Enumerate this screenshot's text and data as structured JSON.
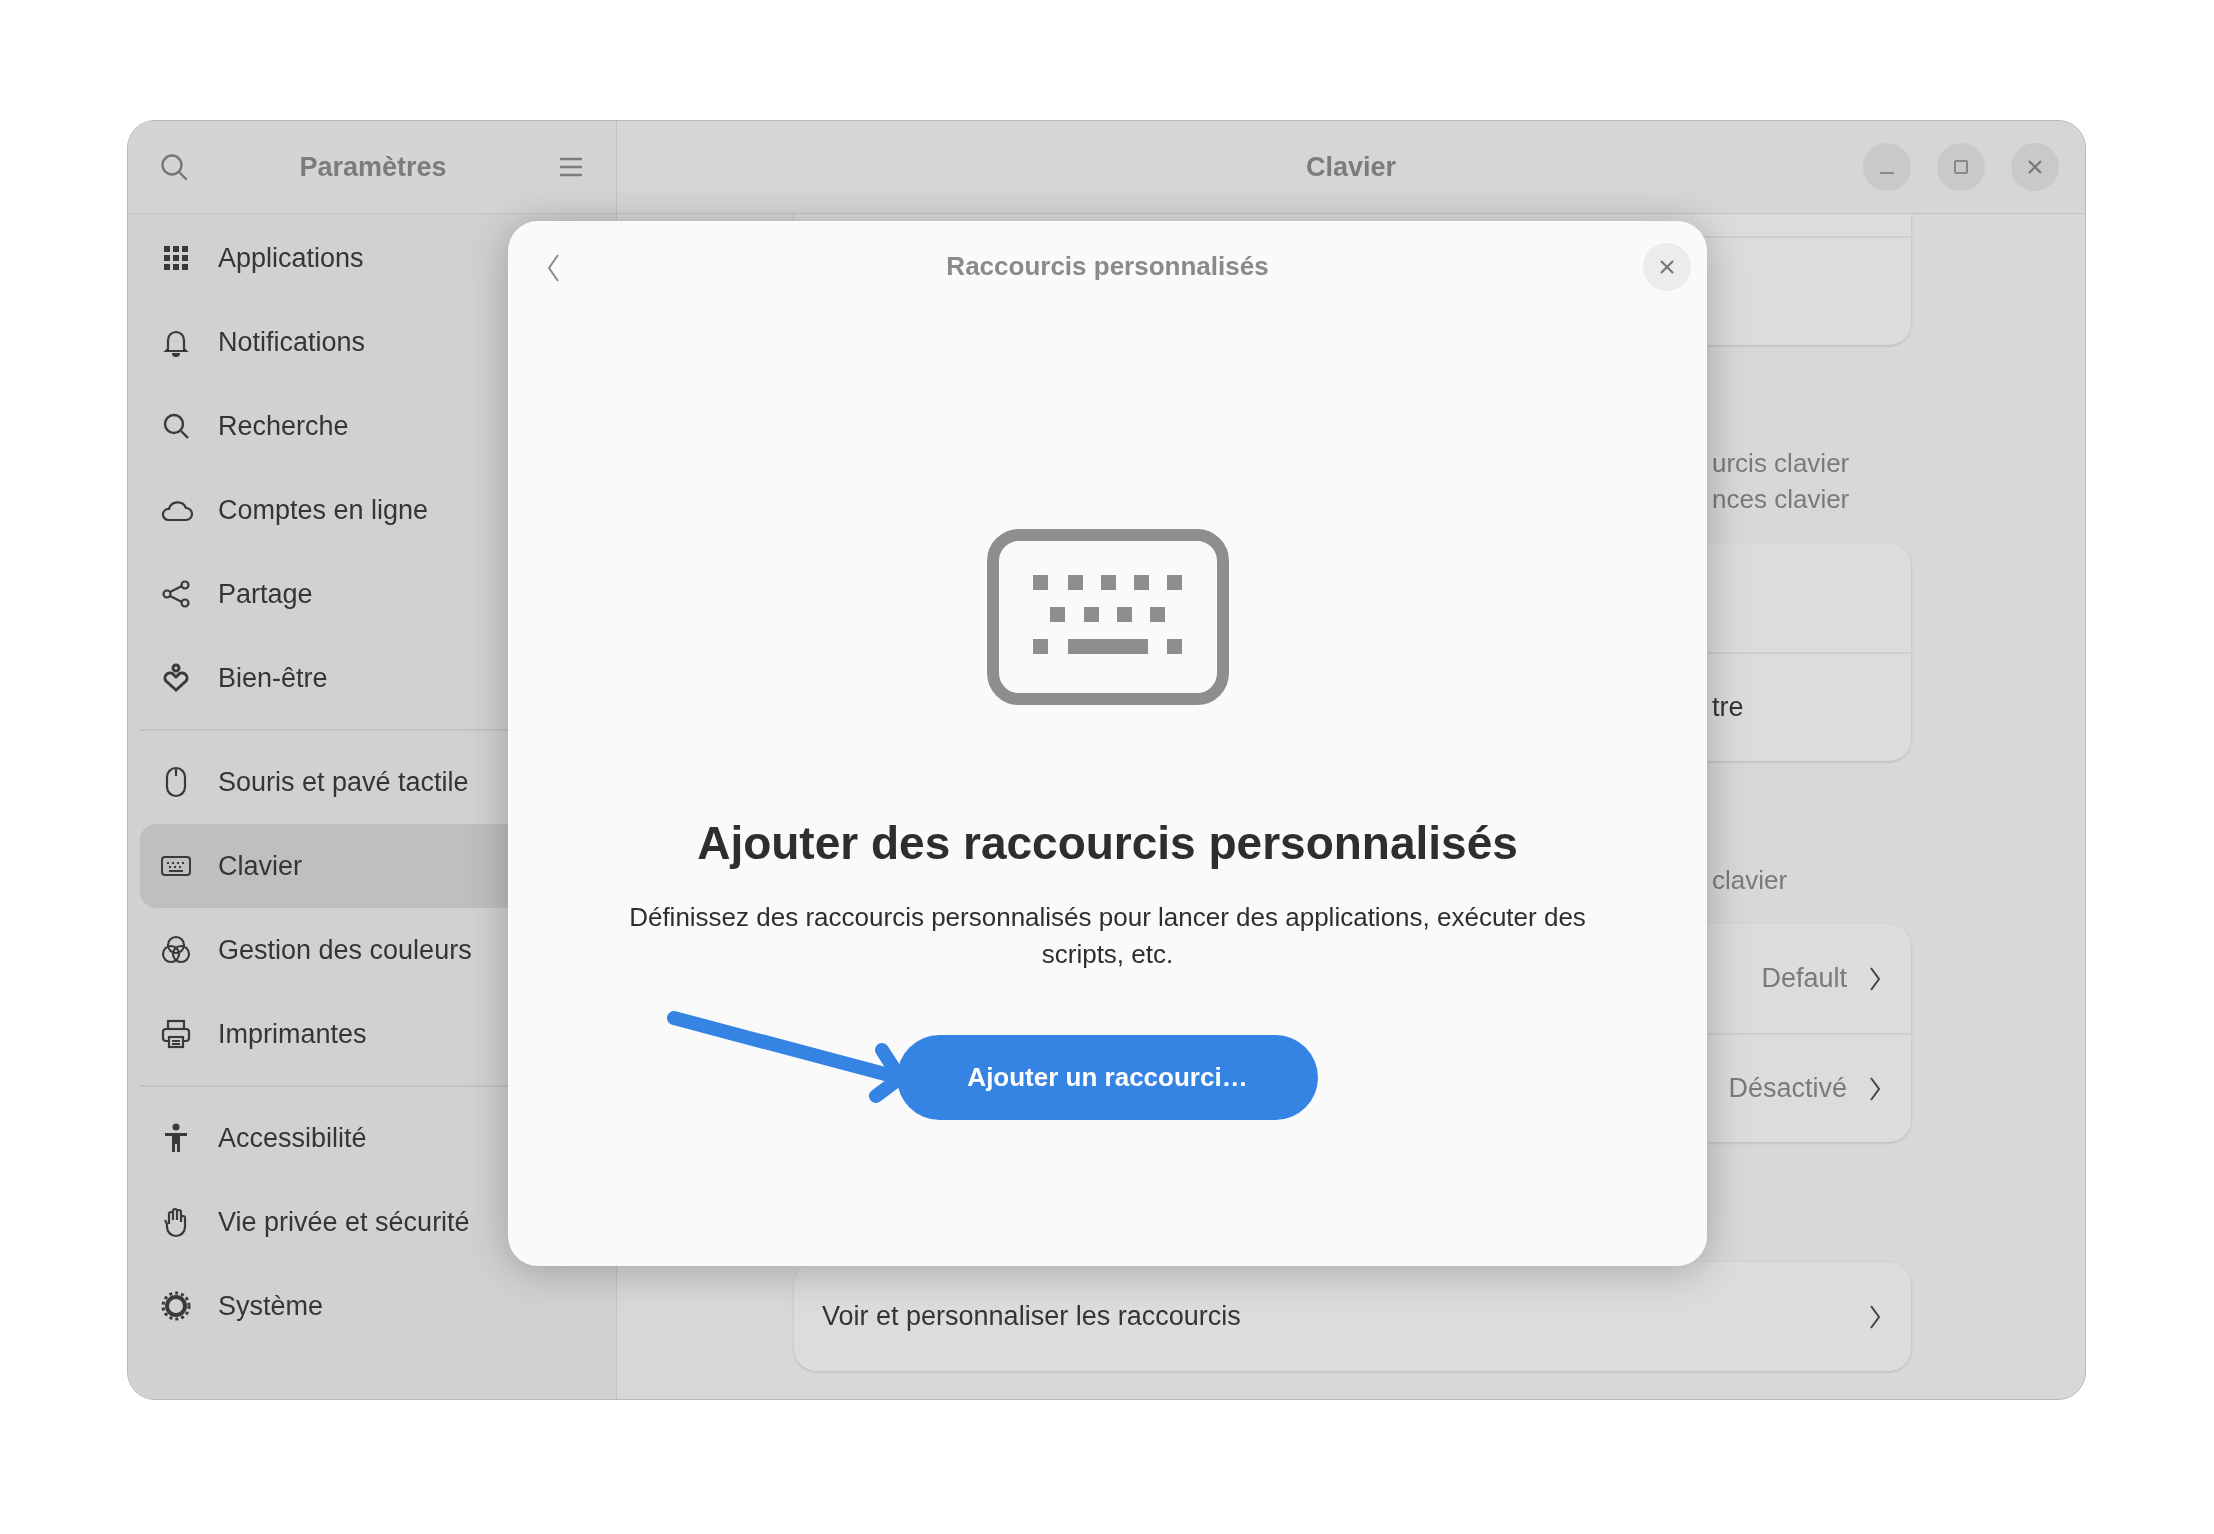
{
  "sidebar": {
    "title": "Paramètres",
    "sections": [
      {
        "items": [
          {
            "label": "Applications",
            "selected": false
          },
          {
            "label": "Notifications",
            "selected": false
          },
          {
            "label": "Recherche",
            "selected": false
          },
          {
            "label": "Comptes en ligne",
            "selected": false
          },
          {
            "label": "Partage",
            "selected": false
          },
          {
            "label": "Bien-être",
            "selected": false
          }
        ]
      },
      {
        "items": [
          {
            "label": "Souris et pavé tactile",
            "selected": false
          },
          {
            "label": "Clavier",
            "selected": true
          },
          {
            "label": "Gestion des couleurs",
            "selected": false
          },
          {
            "label": "Imprimantes",
            "selected": false
          }
        ]
      },
      {
        "items": [
          {
            "label": "Accessibilité",
            "selected": false
          },
          {
            "label": "Vie privée et sécurité",
            "selected": false
          },
          {
            "label": "Système",
            "selected": false
          }
        ]
      }
    ]
  },
  "main": {
    "title": "Clavier",
    "content": [
      {
        "kind": "card",
        "rows": [
          {
            "chevron": false
          },
          {
            "chevron": false
          }
        ]
      },
      {
        "kind": "caption",
        "lines": [
          "urcis clavier",
          "nces clavier"
        ]
      },
      {
        "kind": "card",
        "rows": [
          {
            "chevron": false
          },
          {
            "label": "tre",
            "chevron": false
          }
        ]
      },
      {
        "kind": "heading",
        "text": "clavier"
      },
      {
        "kind": "card",
        "rows": [
          {
            "value": "Default",
            "chevron": true
          },
          {
            "value": "Désactivé",
            "chevron": true
          }
        ]
      },
      {
        "kind": "card",
        "rows": [
          {
            "label": "Voir et personnaliser les raccourcis",
            "chevron": true
          }
        ]
      }
    ]
  },
  "dialog": {
    "title": "Raccourcis personnalisés",
    "heading": "Ajouter des raccourcis personnalisés",
    "description": "Définissez des raccourcis personnalisés pour lancer des applications, exécuter des scripts, etc.",
    "button": "Ajouter un raccourci…"
  }
}
